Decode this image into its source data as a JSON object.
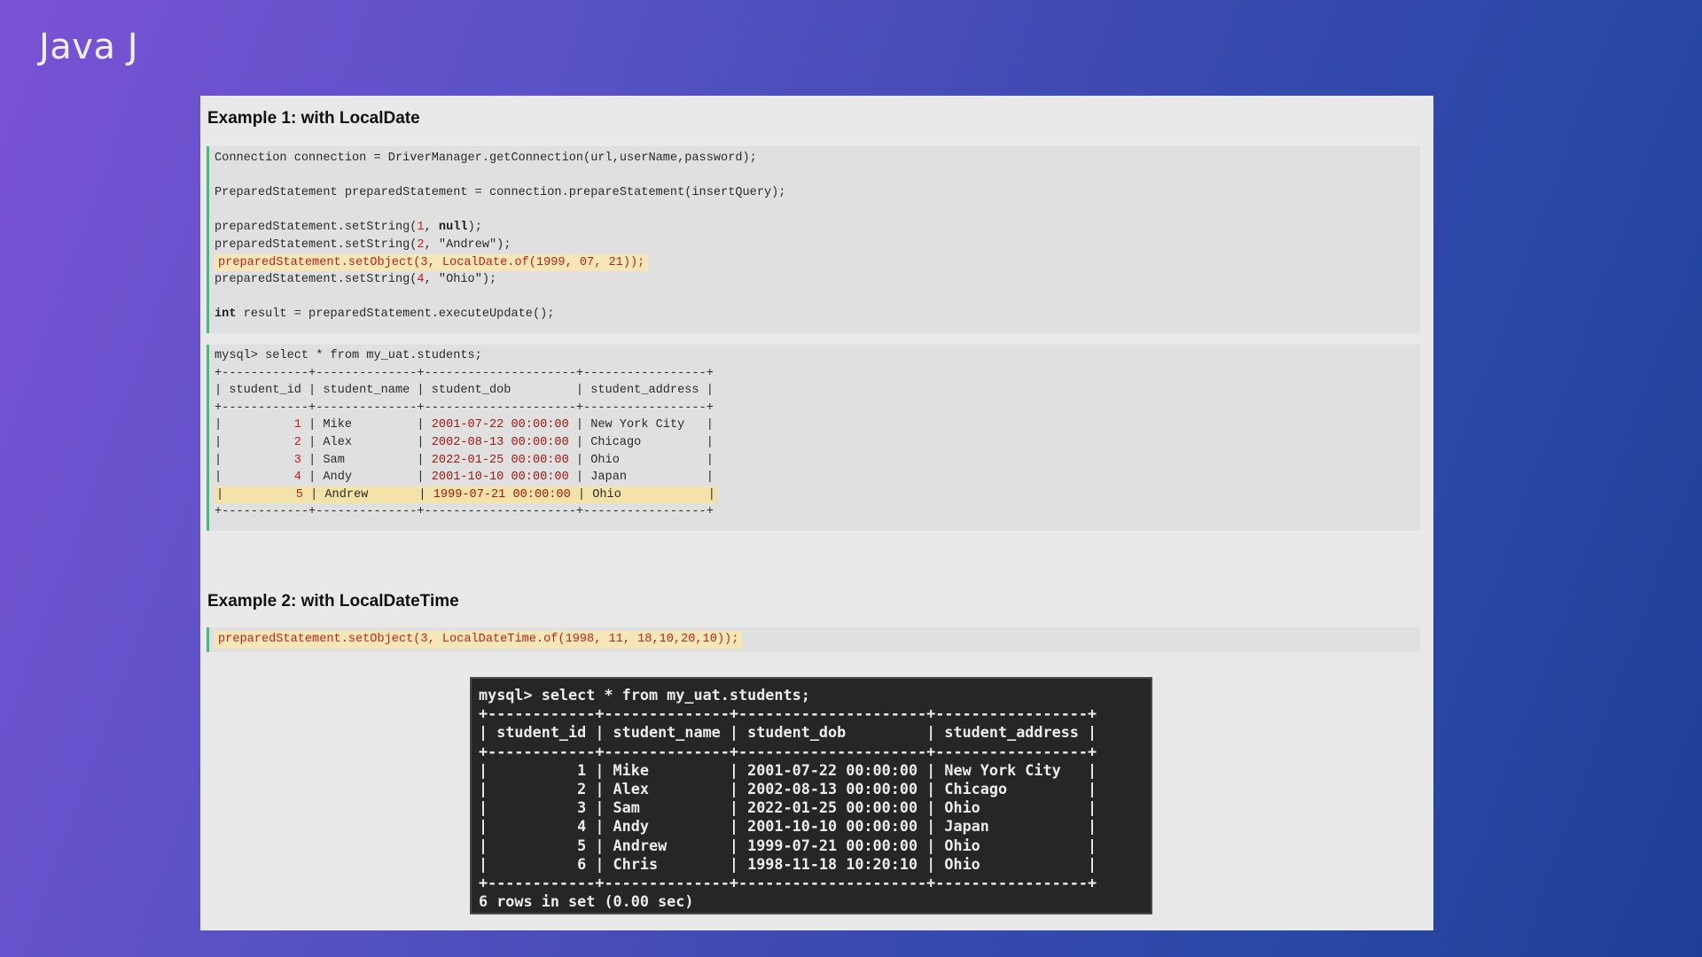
{
  "brand": "Java J",
  "example1": {
    "heading": "Example 1: with LocalDate",
    "code": {
      "conn": "Connection connection = DriverManager.getConnection(url,userName,password);",
      "prep": "PreparedStatement preparedStatement = connection.prepareStatement(insertQuery);",
      "set1_a": "preparedStatement.setString(",
      "set1_n": "1",
      "set1_b": ", ",
      "set1_kw": "null",
      "set1_c": ");",
      "set2_a": "preparedStatement.setString(",
      "set2_n": "2",
      "set2_b": ", \"Andrew\");",
      "set3": "preparedStatement.setObject(3, LocalDate.of(1999, 07, 21));",
      "set4_a": "preparedStatement.setString(",
      "set4_n": "4",
      "set4_b": ", \"Ohio\");",
      "exec_kw": "int",
      "exec": " result = preparedStatement.executeUpdate();"
    },
    "query": {
      "command": "mysql> select * from my_uat.students;",
      "border": "+------------+--------------+---------------------+-----------------+",
      "header": "| student_id | student_name | student_dob         | student_address |",
      "rows": [
        {
          "pre": "|          ",
          "id": "1",
          "mid": " | Mike         | ",
          "dob": "2001-07-22 00:00:00",
          "post": " | New York City   |"
        },
        {
          "pre": "|          ",
          "id": "2",
          "mid": " | Alex         | ",
          "dob": "2002-08-13 00:00:00",
          "post": " | Chicago         |"
        },
        {
          "pre": "|          ",
          "id": "3",
          "mid": " | Sam          | ",
          "dob": "2022-01-25 00:00:00",
          "post": " | Ohio            |"
        },
        {
          "pre": "|          ",
          "id": "4",
          "mid": " | Andy         | ",
          "dob": "2001-10-10 00:00:00",
          "post": " | Japan           |"
        },
        {
          "pre": "|          ",
          "id": "5",
          "mid": " | Andrew       | ",
          "dob": "1999-07-21 00:00:00",
          "post": " | Ohio            |"
        }
      ]
    }
  },
  "example2": {
    "heading": "Example 2: with LocalDateTime",
    "code": "preparedStatement.setObject(3, LocalDateTime.of(1998, 11, 18,10,20,10));"
  },
  "terminal": {
    "command": "mysql> select * from my_uat.students;",
    "border": "+------------+--------------+---------------------+-----------------+",
    "header": "| student_id | student_name | student_dob         | student_address |",
    "rows": [
      "|          1 | Mike         | 2001-07-22 00:00:00 | New York City   |",
      "|          2 | Alex         | 2002-08-13 00:00:00 | Chicago         |",
      "|          3 | Sam          | 2022-01-25 00:00:00 | Ohio            |",
      "|          4 | Andy         | 2001-10-10 00:00:00 | Japan           |",
      "|          5 | Andrew       | 1999-07-21 00:00:00 | Ohio            |",
      "|          6 | Chris        | 1998-11-18 10:20:10 | Ohio            |"
    ],
    "footer": "6 rows in set (0.00 sec)"
  }
}
